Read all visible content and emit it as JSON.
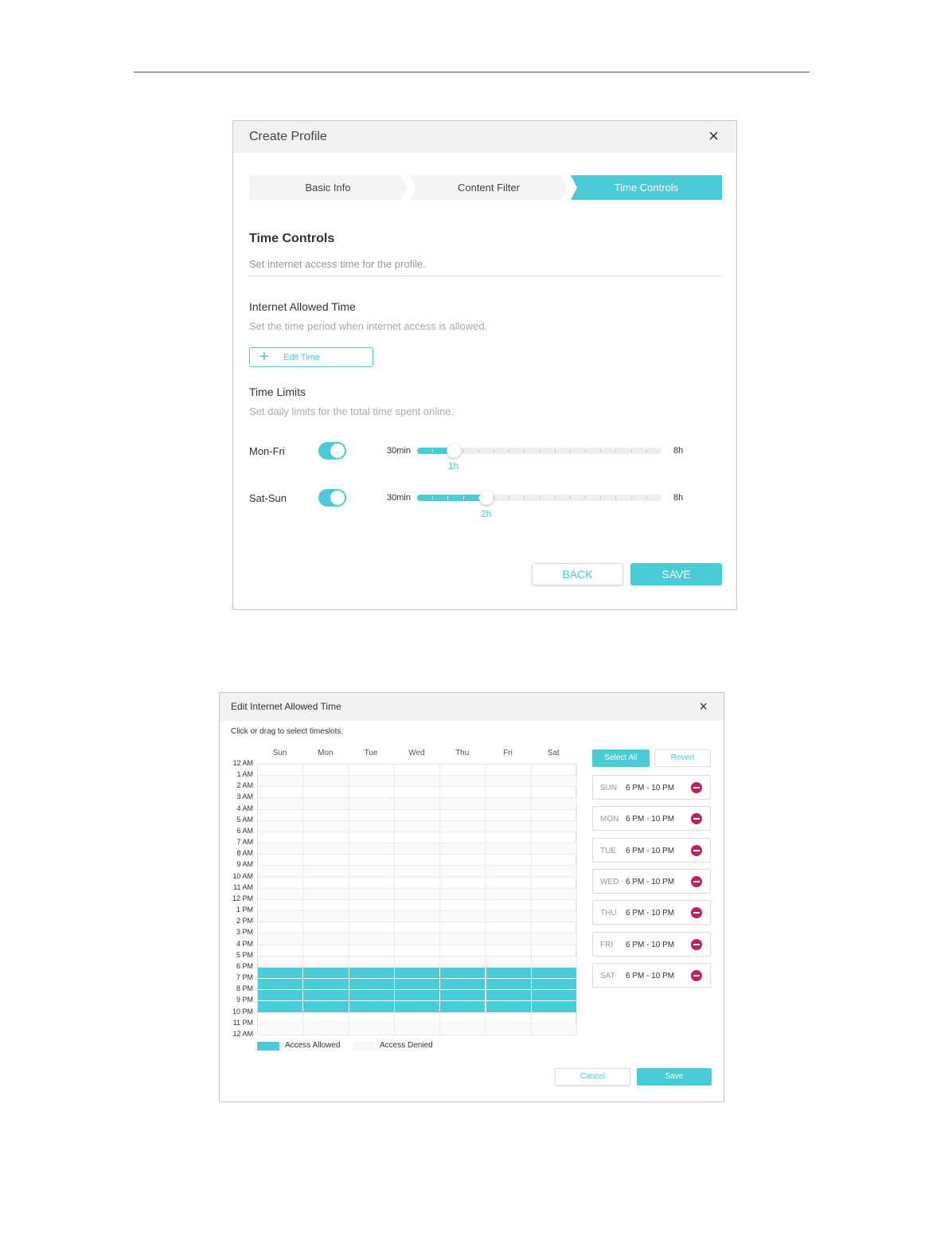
{
  "create_profile": {
    "title": "Create Profile",
    "close": "×",
    "steps": [
      "Basic Info",
      "Content Filter",
      "Time Controls"
    ],
    "active_step": 2,
    "section_title": "Time Controls",
    "section_desc": "Set internet access time for the profile.",
    "allowed_title": "Internet Allowed Time",
    "allowed_desc": "Set the time period when internet access is allowed.",
    "edit_time_label": "Edit Time",
    "limits_title": "Time Limits",
    "limits_desc": "Set daily limits for the total time spent online.",
    "limits": [
      {
        "label": "Mon-Fri",
        "enabled": true,
        "min_label": "30min",
        "max_label": "8h",
        "value_label": "1h",
        "fraction": 0.133,
        "filled_ticks": 2
      },
      {
        "label": "Sat-Sun",
        "enabled": true,
        "min_label": "30min",
        "max_label": "8h",
        "value_label": "2h",
        "fraction": 0.267,
        "filled_ticks": 4
      }
    ],
    "back_label": "BACK",
    "save_label": "SAVE"
  },
  "edit_allowed_time": {
    "title": "Edit Internet Allowed Time",
    "close": "×",
    "hint": "Click or drag to select timeslots.",
    "days": [
      "Sun",
      "Mon",
      "Tue",
      "Wed",
      "Thu",
      "Fri",
      "Sat"
    ],
    "hours": [
      "12 AM",
      "1 AM",
      "2 AM",
      "3 AM",
      "4 AM",
      "5 AM",
      "6 AM",
      "7 AM",
      "8 AM",
      "9 AM",
      "10 AM",
      "11 AM",
      "12 PM",
      "1 PM",
      "2 PM",
      "3 PM",
      "4 PM",
      "5 PM",
      "6 PM",
      "7 PM",
      "8 PM",
      "9 PM",
      "10 PM",
      "11 PM",
      "12 AM"
    ],
    "allowed_hours": [
      18,
      19,
      20,
      21
    ],
    "legend": {
      "allowed": "Access Allowed",
      "denied": "Access Denied"
    },
    "select_all_label": "Select All",
    "revert_label": "Revert",
    "slots": [
      {
        "day": "SUN",
        "range": "6 PM - 10 PM"
      },
      {
        "day": "MON",
        "range": "6 PM - 10 PM"
      },
      {
        "day": "TUE",
        "range": "6 PM - 10 PM"
      },
      {
        "day": "WED",
        "range": "6 PM - 10 PM"
      },
      {
        "day": "THU",
        "range": "6 PM - 10 PM"
      },
      {
        "day": "FRI",
        "range": "6 PM - 10 PM"
      },
      {
        "day": "SAT",
        "range": "6 PM - 10 PM"
      }
    ],
    "cancel_label": "Cancel",
    "save_label": "Save"
  },
  "colors": {
    "accent": "#4acbd6",
    "delete": "#c0205f",
    "header_bg": "#f2f2f2"
  }
}
